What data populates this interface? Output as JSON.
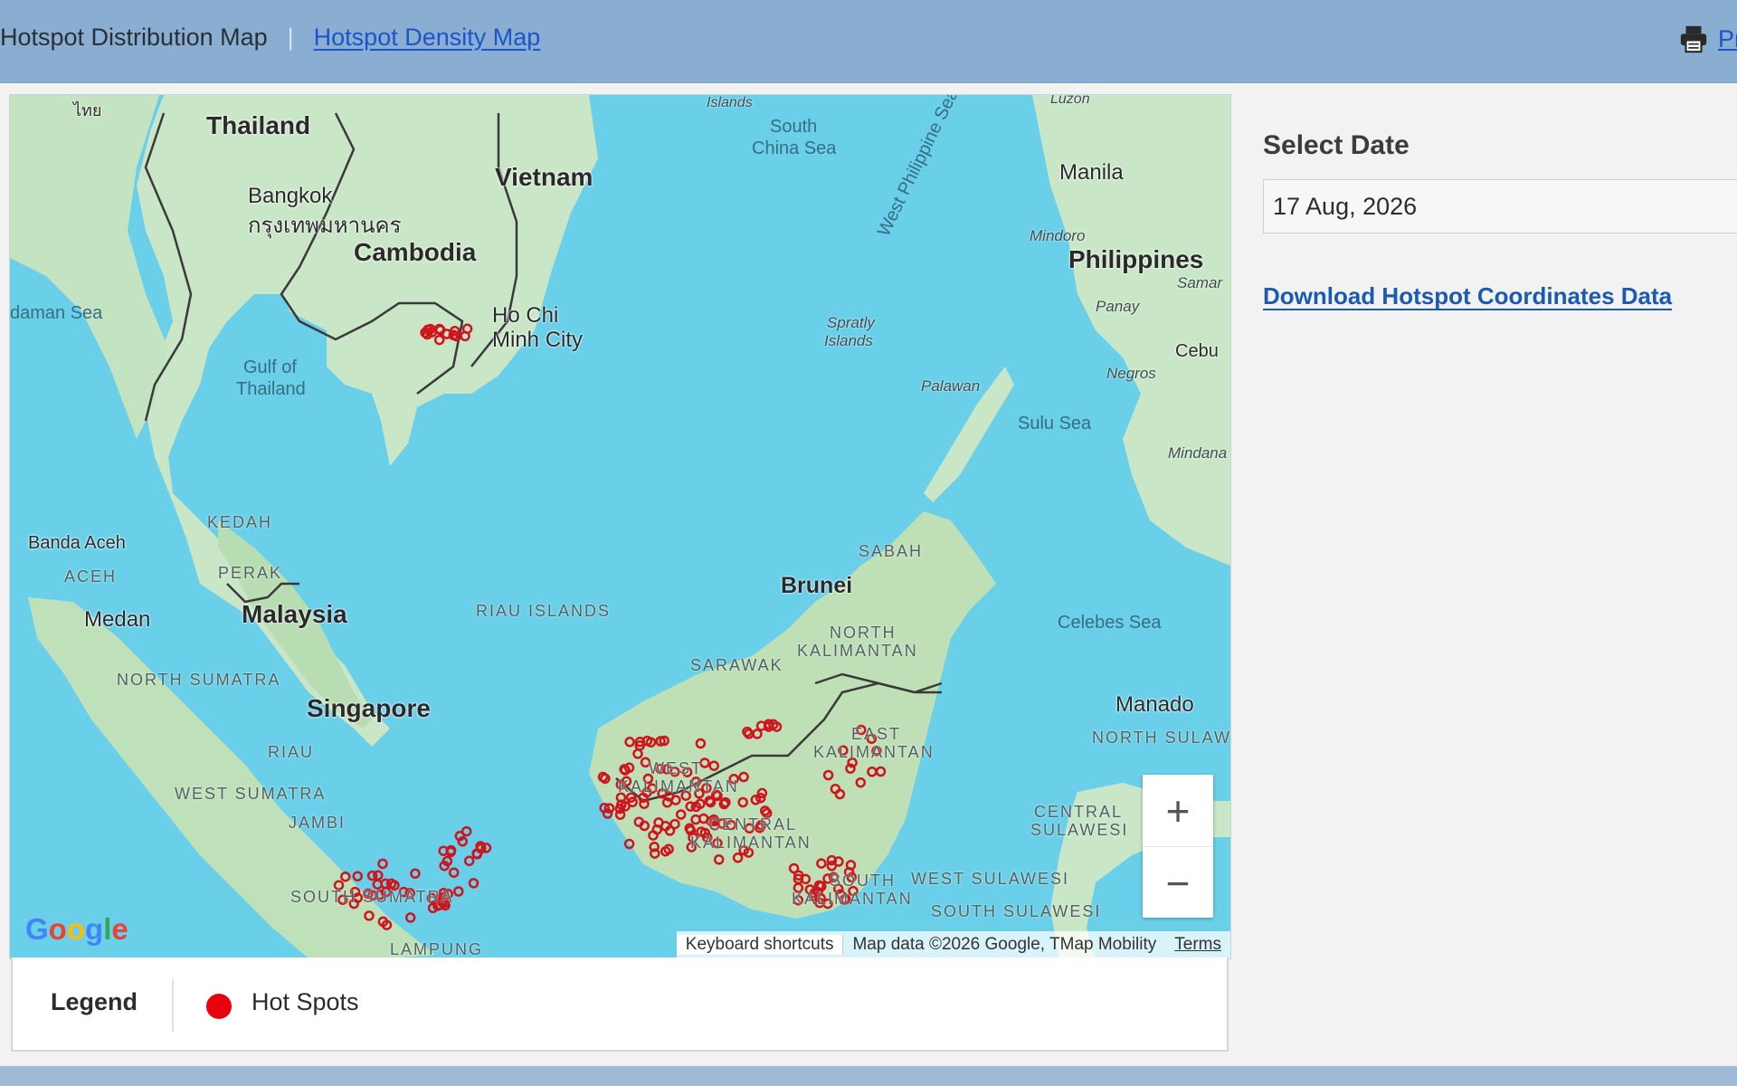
{
  "nav": {
    "distribution_map": "Hotspot Distribution Map",
    "separator": "|",
    "density_map": "Hotspot Density Map",
    "print_label": "Pri"
  },
  "map": {
    "labels": {
      "thailand": "Thailand",
      "vietnam": "Vietnam",
      "cambodia": "Cambodia",
      "malaysia": "Malaysia",
      "singapore": "Singapore",
      "philippines": "Philippines",
      "brunei": "Brunei",
      "bangkok": "Bangkok",
      "bangkok_thai": "กรุงเทพมหานคร",
      "ho_chi_minh_1": "Ho Chi",
      "ho_chi_minh_2": "Minh City",
      "manila": "Manila",
      "manado": "Manado",
      "medan": "Medan",
      "banda_aceh": "Banda Aceh",
      "cebu": "Cebu",
      "south_china_sea_1": "South",
      "south_china_sea_2": "China Sea",
      "gulf_thailand_1": "Gulf of",
      "gulf_thailand_2": "Thailand",
      "andaman_sea": "daman Sea",
      "sulu_sea": "Sulu Sea",
      "celebes_sea": "Celebes Sea",
      "west_philippine_sea": "West Philippine Sea",
      "spratly_1": "Spratly",
      "spratly_2": "Islands",
      "islands_top": "Islands",
      "luzon_top": "Luzon",
      "mindoro": "Mindoro",
      "samar": "Samar",
      "panay": "Panay",
      "negros": "Negros",
      "palawan": "Palawan",
      "mindanao": "Mindana",
      "kedah": "KEDAH",
      "perak": "PERAK",
      "aceh": "ACEH",
      "north_sumatra": "NORTH SUMATRA",
      "riau": "RIAU",
      "west_sumatra": "WEST SUMATRA",
      "jambi": "JAMBI",
      "south_sumatra": "SOUTH SUMATRA",
      "lampung": "LAMPUNG",
      "riau_islands": "RIAU ISLANDS",
      "sarawak": "SARAWAK",
      "sabah": "SABAH",
      "north_kalimantan_1": "NORTH",
      "north_kalimantan_2": "KALIMANTAN",
      "east_kalimantan_1": "EAST",
      "east_kalimantan_2": "KALIMANTAN",
      "west_kalimantan_1": "WEST",
      "west_kalimantan_2": "KALIMANTAN",
      "central_kalimantan_1": "CENTRAL",
      "central_kalimantan_2": "KALIMANTAN",
      "south_kalimantan_1": "SOUTH",
      "south_kalimantan_2": "KALIMANTAN",
      "north_sulawesi": "NORTH SULAW",
      "central_sulawesi_1": "CENTRAL",
      "central_sulawesi_2": "SULAWESI",
      "west_sulawesi": "WEST SULAWESI",
      "south_sulawesi": "SOUTH SULAWESI",
      "thai_top": "ไทย"
    },
    "zoom_in": "+",
    "zoom_out": "−",
    "google_logo": [
      "G",
      "o",
      "o",
      "g",
      "l",
      "e"
    ],
    "attribution": {
      "keyboard": "Keyboard shortcuts",
      "data": "Map data ©2026 Google, TMap Mobility",
      "terms": "Terms"
    },
    "hotspot_color": "#d0141e"
  },
  "legend": {
    "title": "Legend",
    "item_label": "Hot Spots",
    "item_color": "#e8000d"
  },
  "sidebar": {
    "select_date_label": "Select Date",
    "date_value": "17 Aug, 2026",
    "download_link": "Download Hotspot Coordinates Data"
  },
  "icons": {
    "print": "printer-icon"
  }
}
